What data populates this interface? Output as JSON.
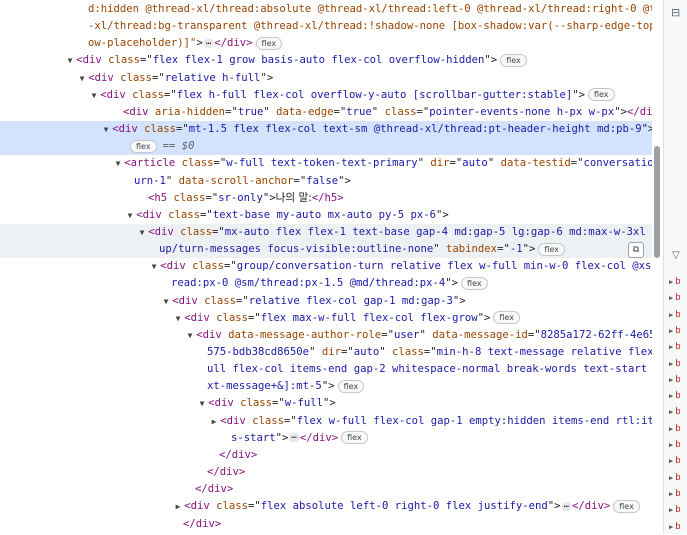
{
  "lines": [
    {
      "indent": 88,
      "seg": [
        [
          "a",
          "d:hidden @thread-xl/thread:absolute @thread-xl/thread:left-0 @thread-xl/thread:right-0 @thread"
        ]
      ]
    },
    {
      "indent": 88,
      "seg": [
        [
          "a",
          "-xl/thread:bg-transparent @thread-xl/thread:!shadow-none [box-shadow:var(--sharp-edge-top-shad"
        ]
      ]
    },
    {
      "indent": 88,
      "seg": [
        [
          "a",
          "ow-placeholder)]\""
        ],
        [
          "p",
          ">"
        ],
        [
          "ell",
          "…"
        ],
        [
          "t",
          "</div>"
        ]
      ],
      "badge": "flex"
    },
    {
      "indent": 77,
      "tri": "▼",
      "seg": [
        [
          "t",
          "<div "
        ],
        [
          "a",
          "class"
        ],
        [
          "p",
          "=\""
        ],
        [
          "v",
          "flex flex-1 grow basis-auto flex-col overflow-hidden"
        ],
        [
          "p",
          "\">"
        ]
      ],
      "badge": "flex"
    },
    {
      "indent": 89,
      "tri": "▼",
      "seg": [
        [
          "t",
          "<div "
        ],
        [
          "a",
          "class"
        ],
        [
          "p",
          "=\""
        ],
        [
          "v",
          "relative h-full"
        ],
        [
          "p",
          "\">"
        ]
      ]
    },
    {
      "indent": 101,
      "tri": "▼",
      "seg": [
        [
          "t",
          "<div "
        ],
        [
          "a",
          "class"
        ],
        [
          "p",
          "=\""
        ],
        [
          "v",
          "flex h-full flex-col overflow-y-auto [scrollbar-gutter:stable]"
        ],
        [
          "p",
          "\">"
        ]
      ],
      "badge": "flex"
    },
    {
      "indent": 123,
      "seg": [
        [
          "t",
          "<div "
        ],
        [
          "a",
          "aria-hidden"
        ],
        [
          "p",
          "=\""
        ],
        [
          "v",
          "true"
        ],
        [
          "p",
          "\" "
        ],
        [
          "a",
          "data-edge"
        ],
        [
          "p",
          "=\""
        ],
        [
          "v",
          "true"
        ],
        [
          "p",
          "\" "
        ],
        [
          "a",
          "class"
        ],
        [
          "p",
          "=\""
        ],
        [
          "v",
          "pointer-events-none h-px w-px"
        ],
        [
          "p",
          "\">"
        ],
        [
          "t",
          "</div>"
        ]
      ]
    },
    {
      "indent": 113,
      "tri": "▼",
      "selected": true,
      "seg": [
        [
          "t",
          "<div "
        ],
        [
          "a",
          "class"
        ],
        [
          "p",
          "=\""
        ],
        [
          "v",
          "mt-1.5 flex flex-col text-sm @thread-xl/thread:pt-header-height md:pb-9"
        ],
        [
          "p",
          "\">"
        ]
      ]
    },
    {
      "indent": 127,
      "selected": true,
      "seg": [],
      "badge": "flex",
      "tail": "== $0"
    },
    {
      "indent": 125,
      "tri": "▼",
      "seg": [
        [
          "t",
          "<article "
        ],
        [
          "a",
          "class"
        ],
        [
          "p",
          "=\""
        ],
        [
          "v",
          "w-full text-token-text-primary"
        ],
        [
          "p",
          "\" "
        ],
        [
          "a",
          "dir"
        ],
        [
          "p",
          "=\""
        ],
        [
          "v",
          "auto"
        ],
        [
          "p",
          "\" "
        ],
        [
          "a",
          "data-testid"
        ],
        [
          "p",
          "=\""
        ],
        [
          "v",
          "conversation-t"
        ]
      ]
    },
    {
      "indent": 134,
      "seg": [
        [
          "v",
          "urn-1"
        ],
        [
          "p",
          "\" "
        ],
        [
          "a",
          "data-scroll-anchor"
        ],
        [
          "p",
          "=\""
        ],
        [
          "v",
          "false"
        ],
        [
          "p",
          "\">"
        ]
      ]
    },
    {
      "indent": 148,
      "seg": [
        [
          "t",
          "<h5 "
        ],
        [
          "a",
          "class"
        ],
        [
          "p",
          "=\""
        ],
        [
          "v",
          "sr-only"
        ],
        [
          "p",
          "\">"
        ],
        [
          "txt",
          "나의 말:"
        ],
        [
          "t",
          "</h5>"
        ]
      ]
    },
    {
      "indent": 137,
      "tri": "▼",
      "seg": [
        [
          "t",
          "<div "
        ],
        [
          "a",
          "class"
        ],
        [
          "p",
          "=\""
        ],
        [
          "v",
          "text-base my-auto mx-auto py-5 px-6"
        ],
        [
          "p",
          "\">"
        ]
      ]
    },
    {
      "indent": 149,
      "tri": "▼",
      "hover": true,
      "seg": [
        [
          "t",
          "<div "
        ],
        [
          "a",
          "class"
        ],
        [
          "p",
          "=\""
        ],
        [
          "v",
          "mx-auto flex flex-1 text-base gap-4 md:gap-5 lg:gap-6 md:max-w-3xl gro"
        ]
      ]
    },
    {
      "indent": 159,
      "hover": true,
      "seg": [
        [
          "v",
          "up/turn-messages focus-visible:outline-none"
        ],
        [
          "p",
          "\" "
        ],
        [
          "a",
          "tabindex"
        ],
        [
          "p",
          "=\""
        ],
        [
          "v",
          "-1"
        ],
        [
          "p",
          "\">"
        ]
      ],
      "badge": "flex"
    },
    {
      "indent": 161,
      "tri": "▼",
      "seg": [
        [
          "t",
          "<div "
        ],
        [
          "a",
          "class"
        ],
        [
          "p",
          "=\""
        ],
        [
          "v",
          "group/conversation-turn relative flex w-full min-w-0 flex-col @xs/th"
        ]
      ]
    },
    {
      "indent": 171,
      "seg": [
        [
          "v",
          "read:px-0 @sm/thread:px-1.5 @md/thread:px-4"
        ],
        [
          "p",
          "\">"
        ]
      ],
      "badge": "flex"
    },
    {
      "indent": 173,
      "tri": "▼",
      "seg": [
        [
          "t",
          "<div "
        ],
        [
          "a",
          "class"
        ],
        [
          "p",
          "=\""
        ],
        [
          "v",
          "relative flex-col gap-1 md:gap-3"
        ],
        [
          "p",
          "\">"
        ]
      ]
    },
    {
      "indent": 185,
      "tri": "▼",
      "seg": [
        [
          "t",
          "<div "
        ],
        [
          "a",
          "class"
        ],
        [
          "p",
          "=\""
        ],
        [
          "v",
          "flex max-w-full flex-col flex-grow"
        ],
        [
          "p",
          "\">"
        ]
      ],
      "badge": "flex"
    },
    {
      "indent": 197,
      "tri": "▼",
      "seg": [
        [
          "t",
          "<div "
        ],
        [
          "a",
          "data-message-author-role"
        ],
        [
          "p",
          "=\""
        ],
        [
          "v",
          "user"
        ],
        [
          "p",
          "\" "
        ],
        [
          "a",
          "data-message-id"
        ],
        [
          "p",
          "=\""
        ],
        [
          "v",
          "8285a172-62ff-4e65-8"
        ]
      ]
    },
    {
      "indent": 207,
      "seg": [
        [
          "v",
          "575-bdb38cd8650e"
        ],
        [
          "p",
          "\" "
        ],
        [
          "a",
          "dir"
        ],
        [
          "p",
          "=\""
        ],
        [
          "v",
          "auto"
        ],
        [
          "p",
          "\" "
        ],
        [
          "a",
          "class"
        ],
        [
          "p",
          "=\""
        ],
        [
          "v",
          "min-h-8 text-message relative flex w-f"
        ]
      ]
    },
    {
      "indent": 207,
      "seg": [
        [
          "v",
          "ull flex-col items-end gap-2 whitespace-normal break-words text-start [.te"
        ]
      ]
    },
    {
      "indent": 207,
      "seg": [
        [
          "v",
          "xt-message+&]:mt-5"
        ],
        [
          "p",
          "\">"
        ]
      ],
      "badge": "flex"
    },
    {
      "indent": 209,
      "tri": "▼",
      "seg": [
        [
          "t",
          "<div "
        ],
        [
          "a",
          "class"
        ],
        [
          "p",
          "=\""
        ],
        [
          "v",
          "w-full"
        ],
        [
          "p",
          "\">"
        ]
      ]
    },
    {
      "indent": 221,
      "tri": "▶",
      "seg": [
        [
          "t",
          "<div "
        ],
        [
          "a",
          "class"
        ],
        [
          "p",
          "=\""
        ],
        [
          "v",
          "flex w-full flex-col gap-1 empty:hidden items-end rtl:item"
        ]
      ]
    },
    {
      "indent": 231,
      "seg": [
        [
          "v",
          "s-start"
        ],
        [
          "p",
          "\">"
        ],
        [
          "ell",
          "…"
        ],
        [
          "t",
          "</div>"
        ]
      ],
      "badge": "flex"
    },
    {
      "indent": 219,
      "seg": [
        [
          "t",
          "</div>"
        ]
      ]
    },
    {
      "indent": 207,
      "seg": [
        [
          "t",
          "</div>"
        ]
      ]
    },
    {
      "indent": 195,
      "seg": [
        [
          "t",
          "</div>"
        ]
      ]
    },
    {
      "indent": 185,
      "tri": "▶",
      "seg": [
        [
          "t",
          "<div "
        ],
        [
          "a",
          "class"
        ],
        [
          "p",
          "=\""
        ],
        [
          "v",
          "flex absolute left-0 right-0 flex justify-end"
        ],
        [
          "p",
          "\">"
        ],
        [
          "ell",
          "…"
        ],
        [
          "t",
          "</div>"
        ]
      ],
      "badge": "flex"
    },
    {
      "indent": 183,
      "seg": [
        [
          "t",
          "</div>"
        ]
      ]
    }
  ],
  "side": {
    "rows": [
      "b",
      "b",
      "b",
      "b",
      "b",
      "b",
      "b",
      "b",
      "b",
      "b",
      "b",
      "b",
      "b",
      "b",
      "b",
      "b"
    ]
  },
  "colors": {
    "selected": "#d3e3fd",
    "tag": "#881280",
    "attr": "#994500",
    "value": "#1a1aa6"
  }
}
